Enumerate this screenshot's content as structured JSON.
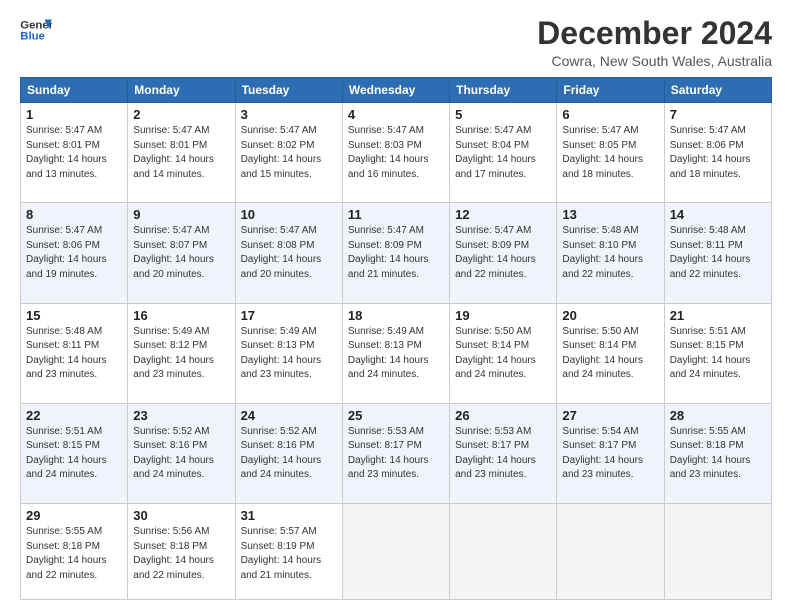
{
  "logo": {
    "line1": "General",
    "line2": "Blue"
  },
  "title": "December 2024",
  "subtitle": "Cowra, New South Wales, Australia",
  "days_of_week": [
    "Sunday",
    "Monday",
    "Tuesday",
    "Wednesday",
    "Thursday",
    "Friday",
    "Saturday"
  ],
  "weeks": [
    [
      {
        "day": "1",
        "info": "Sunrise: 5:47 AM\nSunset: 8:01 PM\nDaylight: 14 hours\nand 13 minutes."
      },
      {
        "day": "2",
        "info": "Sunrise: 5:47 AM\nSunset: 8:01 PM\nDaylight: 14 hours\nand 14 minutes."
      },
      {
        "day": "3",
        "info": "Sunrise: 5:47 AM\nSunset: 8:02 PM\nDaylight: 14 hours\nand 15 minutes."
      },
      {
        "day": "4",
        "info": "Sunrise: 5:47 AM\nSunset: 8:03 PM\nDaylight: 14 hours\nand 16 minutes."
      },
      {
        "day": "5",
        "info": "Sunrise: 5:47 AM\nSunset: 8:04 PM\nDaylight: 14 hours\nand 17 minutes."
      },
      {
        "day": "6",
        "info": "Sunrise: 5:47 AM\nSunset: 8:05 PM\nDaylight: 14 hours\nand 18 minutes."
      },
      {
        "day": "7",
        "info": "Sunrise: 5:47 AM\nSunset: 8:06 PM\nDaylight: 14 hours\nand 18 minutes."
      }
    ],
    [
      {
        "day": "8",
        "info": "Sunrise: 5:47 AM\nSunset: 8:06 PM\nDaylight: 14 hours\nand 19 minutes."
      },
      {
        "day": "9",
        "info": "Sunrise: 5:47 AM\nSunset: 8:07 PM\nDaylight: 14 hours\nand 20 minutes."
      },
      {
        "day": "10",
        "info": "Sunrise: 5:47 AM\nSunset: 8:08 PM\nDaylight: 14 hours\nand 20 minutes."
      },
      {
        "day": "11",
        "info": "Sunrise: 5:47 AM\nSunset: 8:09 PM\nDaylight: 14 hours\nand 21 minutes."
      },
      {
        "day": "12",
        "info": "Sunrise: 5:47 AM\nSunset: 8:09 PM\nDaylight: 14 hours\nand 22 minutes."
      },
      {
        "day": "13",
        "info": "Sunrise: 5:48 AM\nSunset: 8:10 PM\nDaylight: 14 hours\nand 22 minutes."
      },
      {
        "day": "14",
        "info": "Sunrise: 5:48 AM\nSunset: 8:11 PM\nDaylight: 14 hours\nand 22 minutes."
      }
    ],
    [
      {
        "day": "15",
        "info": "Sunrise: 5:48 AM\nSunset: 8:11 PM\nDaylight: 14 hours\nand 23 minutes."
      },
      {
        "day": "16",
        "info": "Sunrise: 5:49 AM\nSunset: 8:12 PM\nDaylight: 14 hours\nand 23 minutes."
      },
      {
        "day": "17",
        "info": "Sunrise: 5:49 AM\nSunset: 8:13 PM\nDaylight: 14 hours\nand 23 minutes."
      },
      {
        "day": "18",
        "info": "Sunrise: 5:49 AM\nSunset: 8:13 PM\nDaylight: 14 hours\nand 24 minutes."
      },
      {
        "day": "19",
        "info": "Sunrise: 5:50 AM\nSunset: 8:14 PM\nDaylight: 14 hours\nand 24 minutes."
      },
      {
        "day": "20",
        "info": "Sunrise: 5:50 AM\nSunset: 8:14 PM\nDaylight: 14 hours\nand 24 minutes."
      },
      {
        "day": "21",
        "info": "Sunrise: 5:51 AM\nSunset: 8:15 PM\nDaylight: 14 hours\nand 24 minutes."
      }
    ],
    [
      {
        "day": "22",
        "info": "Sunrise: 5:51 AM\nSunset: 8:15 PM\nDaylight: 14 hours\nand 24 minutes."
      },
      {
        "day": "23",
        "info": "Sunrise: 5:52 AM\nSunset: 8:16 PM\nDaylight: 14 hours\nand 24 minutes."
      },
      {
        "day": "24",
        "info": "Sunrise: 5:52 AM\nSunset: 8:16 PM\nDaylight: 14 hours\nand 24 minutes."
      },
      {
        "day": "25",
        "info": "Sunrise: 5:53 AM\nSunset: 8:17 PM\nDaylight: 14 hours\nand 23 minutes."
      },
      {
        "day": "26",
        "info": "Sunrise: 5:53 AM\nSunset: 8:17 PM\nDaylight: 14 hours\nand 23 minutes."
      },
      {
        "day": "27",
        "info": "Sunrise: 5:54 AM\nSunset: 8:17 PM\nDaylight: 14 hours\nand 23 minutes."
      },
      {
        "day": "28",
        "info": "Sunrise: 5:55 AM\nSunset: 8:18 PM\nDaylight: 14 hours\nand 23 minutes."
      }
    ],
    [
      {
        "day": "29",
        "info": "Sunrise: 5:55 AM\nSunset: 8:18 PM\nDaylight: 14 hours\nand 22 minutes."
      },
      {
        "day": "30",
        "info": "Sunrise: 5:56 AM\nSunset: 8:18 PM\nDaylight: 14 hours\nand 22 minutes."
      },
      {
        "day": "31",
        "info": "Sunrise: 5:57 AM\nSunset: 8:19 PM\nDaylight: 14 hours\nand 21 minutes."
      },
      {
        "day": "",
        "info": ""
      },
      {
        "day": "",
        "info": ""
      },
      {
        "day": "",
        "info": ""
      },
      {
        "day": "",
        "info": ""
      }
    ]
  ]
}
